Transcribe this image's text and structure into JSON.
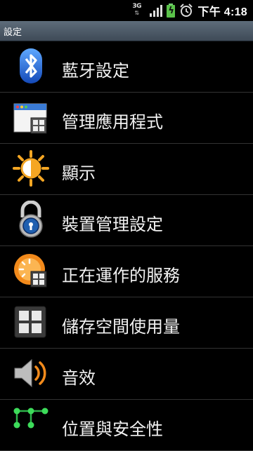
{
  "status_bar": {
    "network_type": "3G",
    "time": "下午 4:18",
    "icons": [
      "3g-icon",
      "signal-icon",
      "battery-charging-icon",
      "alarm-icon"
    ]
  },
  "header": {
    "title": "設定"
  },
  "settings": {
    "items": [
      {
        "label": "藍牙設定",
        "icon": "bluetooth-icon"
      },
      {
        "label": "管理應用程式",
        "icon": "manage-apps-icon"
      },
      {
        "label": "顯示",
        "icon": "display-brightness-icon"
      },
      {
        "label": "裝置管理設定",
        "icon": "device-admin-lock-icon"
      },
      {
        "label": "正在運作的服務",
        "icon": "running-services-icon"
      },
      {
        "label": "儲存空間使用量",
        "icon": "storage-grid-icon"
      },
      {
        "label": "音效",
        "icon": "sound-icon"
      },
      {
        "label": "位置與安全性",
        "icon": "location-security-icon"
      }
    ]
  }
}
